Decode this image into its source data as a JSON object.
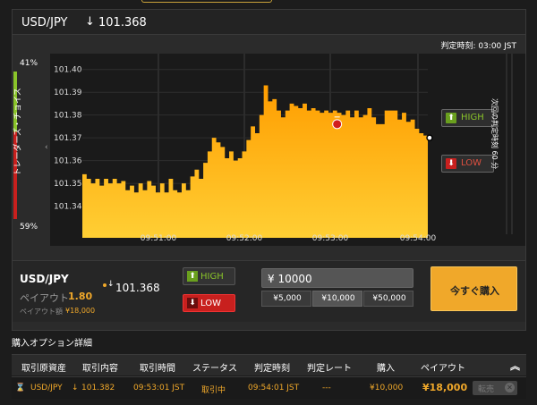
{
  "header": {
    "pair": "USD/JPY",
    "arrow": "↓",
    "price": "101.368"
  },
  "deadline": "判定時刻: 03:00 JST",
  "trader_choice": {
    "label": "トレーダーズ・チョイス",
    "high_pct": "41%",
    "low_pct": "59%",
    "high_fraction": 0.41
  },
  "side_label": "次回の判定時刻 60 分",
  "chart_data": {
    "type": "area",
    "y_ticks": [
      "101.40",
      "101.39",
      "101.38",
      "101.37",
      "101.36",
      "101.35",
      "101.34"
    ],
    "x_ticks": [
      "09:51:00",
      "09:52:00",
      "09:53:00",
      "09:54:00"
    ],
    "ylim": [
      101.33,
      101.405
    ],
    "series": [
      {
        "values": [
          101.354,
          101.352,
          101.35,
          101.352,
          101.349,
          101.352,
          101.35,
          101.352,
          101.35,
          101.351,
          101.347,
          101.349,
          101.346,
          101.35,
          101.347,
          101.351,
          101.349,
          101.346,
          101.35,
          101.346,
          101.352,
          101.347,
          101.346,
          101.35,
          101.347,
          101.353,
          101.356,
          101.352,
          101.359,
          101.364,
          101.37,
          101.368,
          101.366,
          101.361,
          101.364,
          101.36,
          101.361,
          101.364,
          101.369,
          101.375,
          101.372,
          101.38,
          101.393,
          101.386,
          101.387,
          101.382,
          101.379,
          101.382,
          101.385,
          101.384,
          101.383,
          101.385,
          101.382,
          101.383,
          101.382,
          101.381,
          101.382,
          101.381,
          101.382,
          101.381,
          101.38,
          101.382,
          101.379,
          101.382,
          101.379,
          101.38,
          101.383,
          101.379,
          101.376,
          101.376,
          101.382,
          101.382,
          101.382,
          101.378,
          101.381,
          101.377,
          101.378,
          101.374,
          101.372,
          101.371,
          101.37
        ]
      }
    ],
    "entry_marker_value": 101.376,
    "last_value": 101.37
  },
  "high_button": "HIGH",
  "low_button": "LOW",
  "trade": {
    "pair": "USD/JPY",
    "payout_label": "ペイアウト",
    "payout_rate": "1.80",
    "payout_amount_label": "ペイアウト額",
    "payout_amount": "¥18,000",
    "price": "101.368",
    "high_label": "HIGH",
    "low_label": "LOW",
    "amount_value": "¥ 10000",
    "presets": [
      "¥5,000",
      "¥10,000",
      "¥50,000"
    ],
    "buy_now": "今すぐ購入"
  },
  "details": {
    "title": "購入オプション詳細",
    "columns": [
      "取引原資産",
      "取引内容",
      "取引時間",
      "ステータス",
      "判定時刻",
      "判定レート",
      "購入",
      "ペイアウト"
    ],
    "rows": [
      {
        "icon": "⌛",
        "asset": "USD/JPY",
        "direction_arrow": "↓",
        "rate": "101.382",
        "time": "09:53:01 JST",
        "status": "取引中",
        "deadline": "09:54:01 JST",
        "judge_rate": "---",
        "purchase": "¥10,000",
        "payout": "¥18,000",
        "action": "転売"
      }
    ]
  },
  "colors": {
    "accent_gold": "#f0a82a",
    "high_green": "#8ac42a",
    "low_red": "#d21d1d",
    "chart_orange_top": "#ff9d00",
    "chart_orange_bottom": "#ffce30"
  }
}
